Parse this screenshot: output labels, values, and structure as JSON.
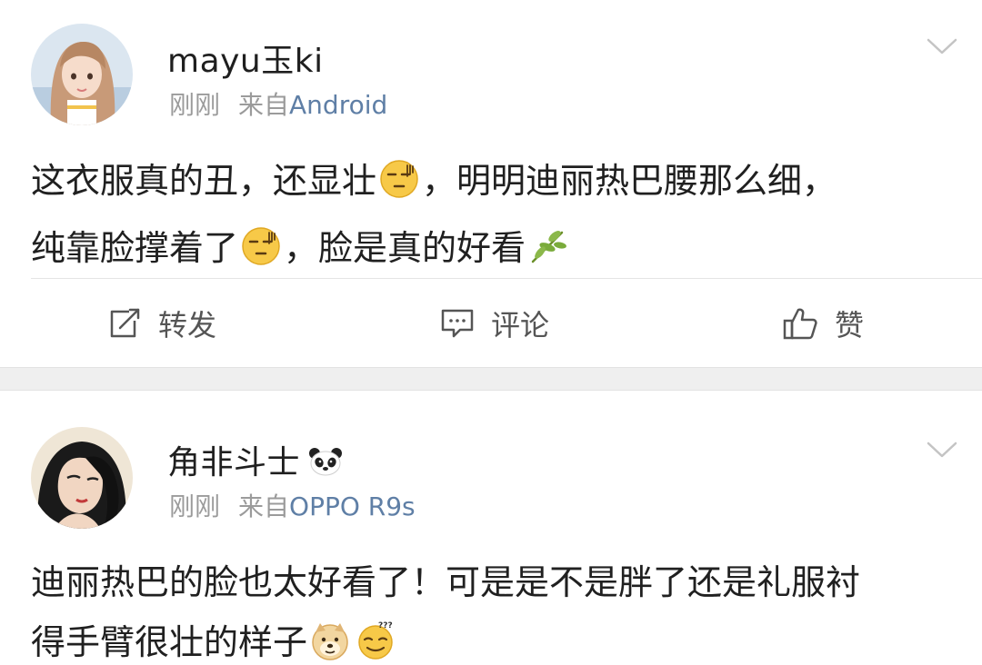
{
  "posts": [
    {
      "username": "mayu玉ki",
      "time": "刚刚",
      "source_prefix": "来自",
      "source_name": "Android",
      "content": [
        {
          "text": "这衣服真的丑，还显壮"
        },
        {
          "emoji": "sweat-face-icon"
        },
        {
          "text": "，明明迪丽热巴腰那么细，"
        },
        {
          "text": "纯靠脸撑着了"
        },
        {
          "emoji": "sweat-face-icon"
        },
        {
          "text": "，脸是真的好看"
        },
        {
          "emoji": "leaf-icon"
        }
      ],
      "actions": {
        "repost": "转发",
        "comment": "评论",
        "like": "赞"
      }
    },
    {
      "username": "角非斗士",
      "badge_icon": "panda-icon",
      "time": "刚刚",
      "source_prefix": "来自",
      "source_name": "OPPO R9s",
      "content": [
        {
          "text": "迪丽热巴的脸也太好看了！可是是不是胖了还是礼服衬"
        },
        {
          "text": "得手臂很壮的样子"
        },
        {
          "emoji": "doge-icon"
        },
        {
          "emoji": "confused-face-icon"
        }
      ]
    }
  ],
  "colors": {
    "source_link": "#5f7fa6",
    "meta_gray": "#9b9b9b",
    "divider_band": "#efefef"
  }
}
